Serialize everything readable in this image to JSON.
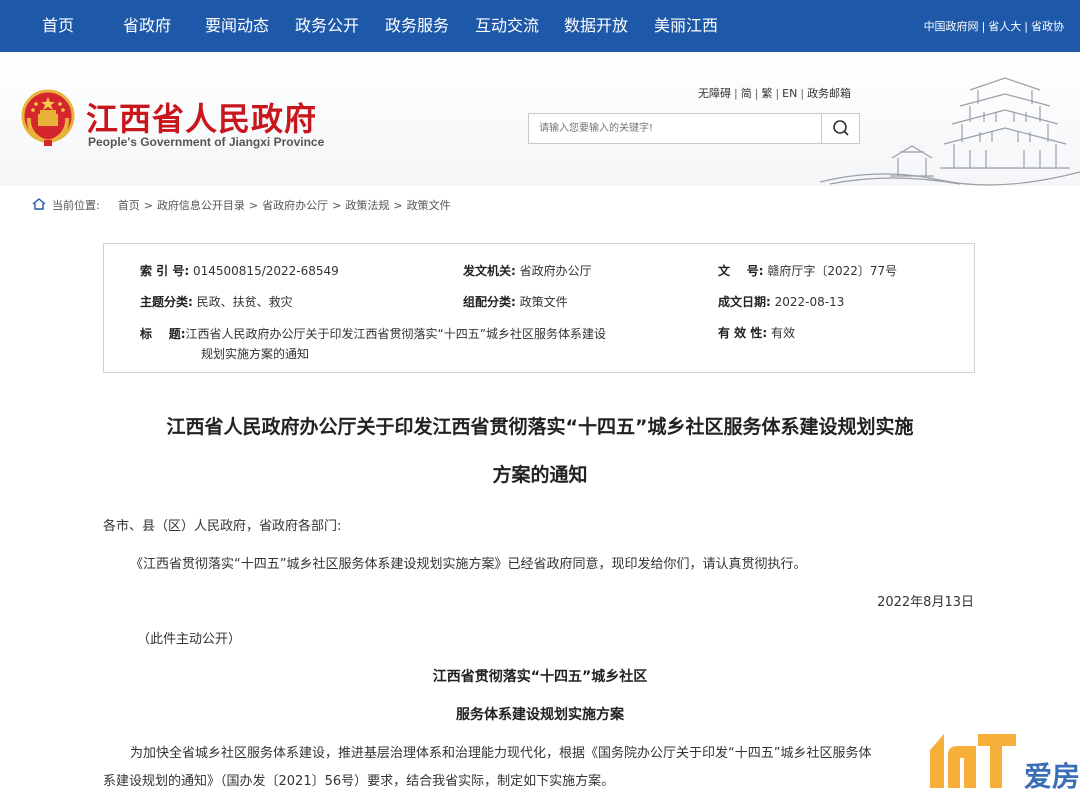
{
  "nav": {
    "items": [
      "首页",
      "省政府",
      "要闻动态",
      "政务公开",
      "政务服务",
      "互动交流",
      "数据开放",
      "美丽江西"
    ],
    "links": [
      "中国政府网",
      "省人大",
      "省政协"
    ],
    "link_sep": "|"
  },
  "header": {
    "title": "江西省人民政府",
    "subtitle": "People's Government of Jiangxi Province",
    "utils": [
      "无障碍",
      "简",
      "繁",
      "EN",
      "政务邮箱"
    ],
    "util_sep": "|",
    "search_placeholder": "请输入您要输入的关键字!"
  },
  "breadcrumb": {
    "label": "当前位置:",
    "items": [
      "首页",
      "政府信息公开目录",
      "省政府办公厅",
      "政策法规",
      "政策文件"
    ],
    "sep": ">"
  },
  "info": {
    "index_label": "索 引 号:",
    "index_value": "014500815/2022-68549",
    "issuer_label": "发文机关:",
    "issuer_value": "省政府办公厅",
    "docno_label": "文    号:",
    "docno_value": "赣府厅字〔2022〕77号",
    "topic_label": "主题分类:",
    "topic_value": "民政、扶贫、救灾",
    "category_label": "组配分类:",
    "category_value": "政策文件",
    "date_label": "成文日期:",
    "date_value": "2022-08-13",
    "title_label": "标    题:",
    "title_line1": "江西省人民政府办公厅关于印发江西省贯彻落实“十四五”城乡社区服务体系建设",
    "title_line2": "规划实施方案的通知",
    "validity_label": "有 效 性:",
    "validity_value": "有效"
  },
  "article": {
    "title_line1": "江西省人民政府办公厅关于印发江西省贯彻落实“十四五”城乡社区服务体系建设规划实施",
    "title_line2": "方案的通知",
    "salutation": "各市、县（区）人民政府，省政府各部门:",
    "body1": "《江西省贯彻落实“十四五”城乡社区服务体系建设规划实施方案》已经省政府同意，现印发给你们，请认真贯彻执行。",
    "date": "2022年8月13日",
    "public_note": "（此件主动公开）",
    "plan_title1": "江西省贯彻落实“十四五”城乡社区",
    "plan_title2": "服务体系建设规划实施方案",
    "plan_p1_line1": "为加快全省城乡社区服务体系建设，推进基层治理体系和治理能力现代化，根据《国务院办公厅关于印发“十四五”城乡社区服务体",
    "plan_p1_line2": "系建设规划的通知》（国办发〔2021〕56号）要求，结合我省实际，制定如下实施方案。"
  },
  "watermark": {
    "text": "爱房"
  },
  "colors": {
    "nav_bg": "#1d58a9",
    "title_red": "#c8161d",
    "watermark_orange": "#f5a623"
  }
}
